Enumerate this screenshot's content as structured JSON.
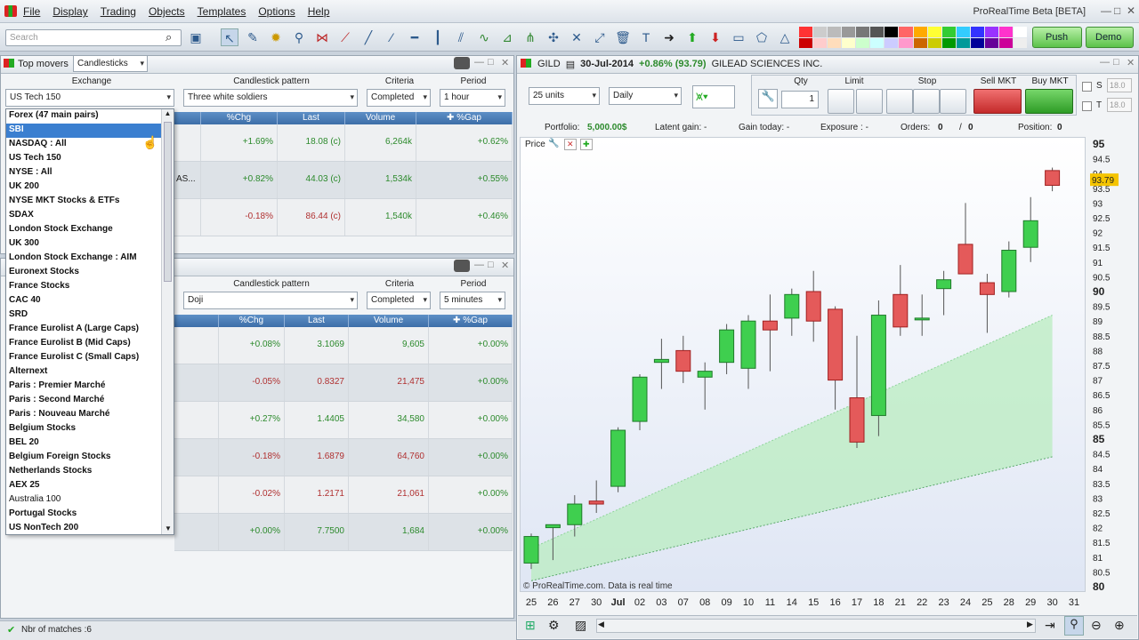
{
  "app": {
    "title": "ProRealTime Beta [BETA]",
    "menu": [
      "File",
      "Display",
      "Trading",
      "Objects",
      "Templates",
      "Options",
      "Help"
    ],
    "search_placeholder": "Search",
    "push_label": "Push",
    "demo_label": "Demo"
  },
  "top_movers": {
    "title": "Top movers",
    "mode": "Candlesticks",
    "exchange_label": "Exchange",
    "exchange_value": "US Tech 150",
    "pattern_label": "Candlestick pattern",
    "pattern_value": "Three white soldiers",
    "criteria_label": "Criteria",
    "criteria_value": "Completed",
    "period_label": "Period",
    "period_value": "1 hour",
    "columns": [
      "%Chg",
      "Last",
      "Volume",
      "%Gap"
    ],
    "rows": [
      {
        "name": "",
        "chg": "+1.69%",
        "last": "18.08 (c)",
        "volume": "6,264k",
        "gap": "+0.62%"
      },
      {
        "name": "AS...",
        "chg": "+0.82%",
        "last": "44.03 (c)",
        "volume": "1,534k",
        "gap": "+0.55%"
      },
      {
        "name": "",
        "chg": "-0.18%",
        "last": "86.44 (c)",
        "volume": "1,540k",
        "gap": "+0.46%"
      }
    ]
  },
  "second_movers": {
    "pattern_label": "Candlestick pattern",
    "pattern_value": "Doji",
    "criteria_label": "Criteria",
    "criteria_value": "Completed",
    "period_label": "Period",
    "period_value": "5 minutes",
    "columns": [
      "%Chg",
      "Last",
      "Volume",
      "%Gap"
    ],
    "rows": [
      {
        "chg": "+0.08%",
        "last": "3.1069",
        "volume": "9,605",
        "gap": "+0.00%"
      },
      {
        "chg": "-0.05%",
        "last": "0.8327",
        "volume": "21,475",
        "gap": "+0.00%"
      },
      {
        "chg": "+0.27%",
        "last": "1.4405",
        "volume": "34,580",
        "gap": "+0.00%"
      },
      {
        "chg": "-0.18%",
        "last": "1.6879",
        "volume": "64,760",
        "gap": "+0.00%"
      },
      {
        "chg": "-0.02%",
        "last": "1.2171",
        "volume": "21,061",
        "gap": "+0.00%"
      },
      {
        "chg": "+0.00%",
        "last": "7.7500",
        "volume": "1,684",
        "gap": "+0.00%"
      }
    ]
  },
  "exchange_dropdown": {
    "items": [
      "Forex (47 main pairs)",
      "SBI",
      "NASDAQ : All",
      "US Tech 150",
      "NYSE : All",
      "UK 200",
      "NYSE MKT Stocks & ETFs",
      "SDAX",
      "London Stock Exchange",
      "UK 300",
      "London Stock Exchange : AIM",
      "Euronext Stocks",
      "France Stocks",
      "CAC 40",
      "SRD",
      "France Eurolist A (Large Caps)",
      "France Eurolist B  (Mid Caps)",
      "France Eurolist C (Small Caps)",
      "Alternext",
      "Paris : Premier Marché",
      "Paris : Second Marché",
      "Paris : Nouveau Marché",
      "Belgium Stocks",
      "BEL 20",
      "Belgium Foreign Stocks",
      "Netherlands Stocks",
      "AEX 25",
      "Australia 100",
      "Portugal Stocks",
      "US NonTech 200"
    ],
    "selected_index": 1
  },
  "status": {
    "matches": "Nbr of matches :6"
  },
  "chart_window": {
    "ticker": "GILD",
    "date": "30-Jul-2014",
    "change": "+0.86% (93.79)",
    "name": "GILEAD SCIENCES INC.",
    "units": "25 units",
    "timeframe": "Daily",
    "qty_label": "Qty",
    "qty_value": "1",
    "limit_label": "Limit",
    "stop_label": "Stop",
    "sell_label": "Sell MKT",
    "buy_label": "Buy MKT",
    "s_label": "S",
    "t_label": "T",
    "s_value": "18.0",
    "t_value": "18.0",
    "portfolio_label": "Portfolio:",
    "portfolio_value": "5,000.00$",
    "latent_label": "Latent gain: -",
    "gain_today_label": "Gain today: -",
    "exposure_label": "Exposure : -",
    "orders_label": "Orders:",
    "orders_value": "0",
    "orders_value2": "0",
    "position_label": "Position:",
    "position_value": "0",
    "price_label": "Price",
    "watermark": "© ProRealTime.com. Data is real time",
    "last_price_tag": "93.79"
  },
  "chart_data": {
    "type": "candlestick",
    "ylim": [
      80,
      95
    ],
    "yticks": [
      "80.5",
      "81",
      "81.5",
      "82",
      "82.5",
      "83",
      "83.5",
      "84",
      "84.5",
      "85",
      "85.5",
      "86",
      "86.5",
      "87",
      "87.5",
      "88",
      "88.5",
      "89",
      "89.5",
      "90",
      "90.5",
      "91",
      "91.5",
      "92",
      "92.5",
      "93",
      "93.5",
      "94",
      "94.5",
      "95"
    ],
    "ylabels_bottom": "80",
    "x_labels": [
      "25",
      "26",
      "27",
      "30",
      "Jul",
      "02",
      "03",
      "07",
      "08",
      "09",
      "10",
      "11",
      "14",
      "15",
      "16",
      "17",
      "18",
      "21",
      "22",
      "23",
      "24",
      "25",
      "28",
      "29",
      "30",
      "31"
    ],
    "candles": [
      {
        "o": 80.8,
        "h": 81.8,
        "l": 80.6,
        "c": 81.7
      },
      {
        "o": 82.0,
        "h": 82.1,
        "l": 80.9,
        "c": 82.1
      },
      {
        "o": 82.1,
        "h": 83.1,
        "l": 81.7,
        "c": 82.8
      },
      {
        "o": 82.9,
        "h": 83.6,
        "l": 82.5,
        "c": 82.8
      },
      {
        "o": 83.4,
        "h": 85.4,
        "l": 83.2,
        "c": 85.3
      },
      {
        "o": 85.6,
        "h": 87.2,
        "l": 85.3,
        "c": 87.1
      },
      {
        "o": 87.6,
        "h": 88.4,
        "l": 86.7,
        "c": 87.7
      },
      {
        "o": 88.0,
        "h": 88.5,
        "l": 86.9,
        "c": 87.3
      },
      {
        "o": 87.1,
        "h": 87.6,
        "l": 86.0,
        "c": 87.3
      },
      {
        "o": 87.6,
        "h": 88.9,
        "l": 87.2,
        "c": 88.7
      },
      {
        "o": 87.4,
        "h": 89.2,
        "l": 86.7,
        "c": 89.0
      },
      {
        "o": 89.0,
        "h": 89.9,
        "l": 87.3,
        "c": 88.7
      },
      {
        "o": 89.1,
        "h": 90.1,
        "l": 88.5,
        "c": 89.9
      },
      {
        "o": 90.0,
        "h": 90.7,
        "l": 88.3,
        "c": 89.0
      },
      {
        "o": 89.4,
        "h": 89.5,
        "l": 86.0,
        "c": 87.0
      },
      {
        "o": 86.4,
        "h": 88.5,
        "l": 84.7,
        "c": 84.9
      },
      {
        "o": 85.8,
        "h": 89.7,
        "l": 85.1,
        "c": 89.2
      },
      {
        "o": 89.9,
        "h": 90.9,
        "l": 88.5,
        "c": 88.8
      },
      {
        "o": 89.1,
        "h": 89.9,
        "l": 88.5,
        "c": 89.1
      },
      {
        "o": 90.1,
        "h": 90.7,
        "l": 89.2,
        "c": 90.4
      },
      {
        "o": 91.6,
        "h": 93.0,
        "l": 90.6,
        "c": 90.6
      },
      {
        "o": 90.3,
        "h": 90.6,
        "l": 88.6,
        "c": 89.9
      },
      {
        "o": 90.0,
        "h": 91.7,
        "l": 89.8,
        "c": 91.4
      },
      {
        "o": 91.5,
        "h": 93.2,
        "l": 91.0,
        "c": 92.4
      },
      {
        "o": 94.1,
        "h": 94.2,
        "l": 93.4,
        "c": 93.6
      }
    ],
    "band_upper_start": 81.3,
    "band_upper_end": 89.2,
    "band_lower_start": 80.2,
    "band_lower_end": 84.4
  }
}
